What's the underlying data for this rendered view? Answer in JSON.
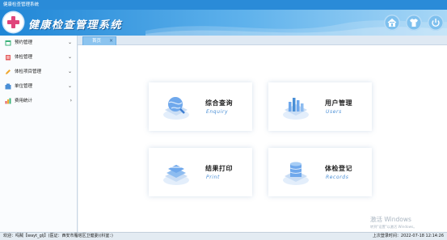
{
  "window": {
    "title": "健康检查管理系统"
  },
  "header": {
    "app_title": "健康检查管理系统",
    "buttons": [
      {
        "icon": "home-icon"
      },
      {
        "icon": "shirt-icon"
      },
      {
        "icon": "power-icon"
      }
    ]
  },
  "sidebar": {
    "items": [
      {
        "label": "预约管理",
        "icon": "calendar-icon"
      },
      {
        "label": "体检管理",
        "icon": "clipboard-icon"
      },
      {
        "label": "体检项目管理",
        "icon": "pencil-icon"
      },
      {
        "label": "单位管理",
        "icon": "building-icon"
      },
      {
        "label": "费用统计",
        "icon": "chart-icon"
      }
    ]
  },
  "tabs": [
    {
      "label": "首页",
      "close": "×"
    }
  ],
  "cards": [
    {
      "title": "综合查询",
      "subtitle": "Enquiry"
    },
    {
      "title": "用户管理",
      "subtitle": "Users"
    },
    {
      "title": "结果打印",
      "subtitle": "Print"
    },
    {
      "title": "体检登记",
      "subtitle": "Records"
    }
  ],
  "watermark": {
    "line1": "激活 Windows",
    "line2": "转到\"设置\"以激活 Windows。"
  },
  "status": {
    "left": "欢迎：吗贼【wayt_glj】(医证：西安市雁塔区卫健委)(科室：)",
    "right": "上次登录时间：2022-07-18 12:14:26"
  },
  "colors": {
    "accent": "#2a8bd8",
    "card_subtitle": "#4a8fd6",
    "logo_cross": "#e0457b"
  }
}
